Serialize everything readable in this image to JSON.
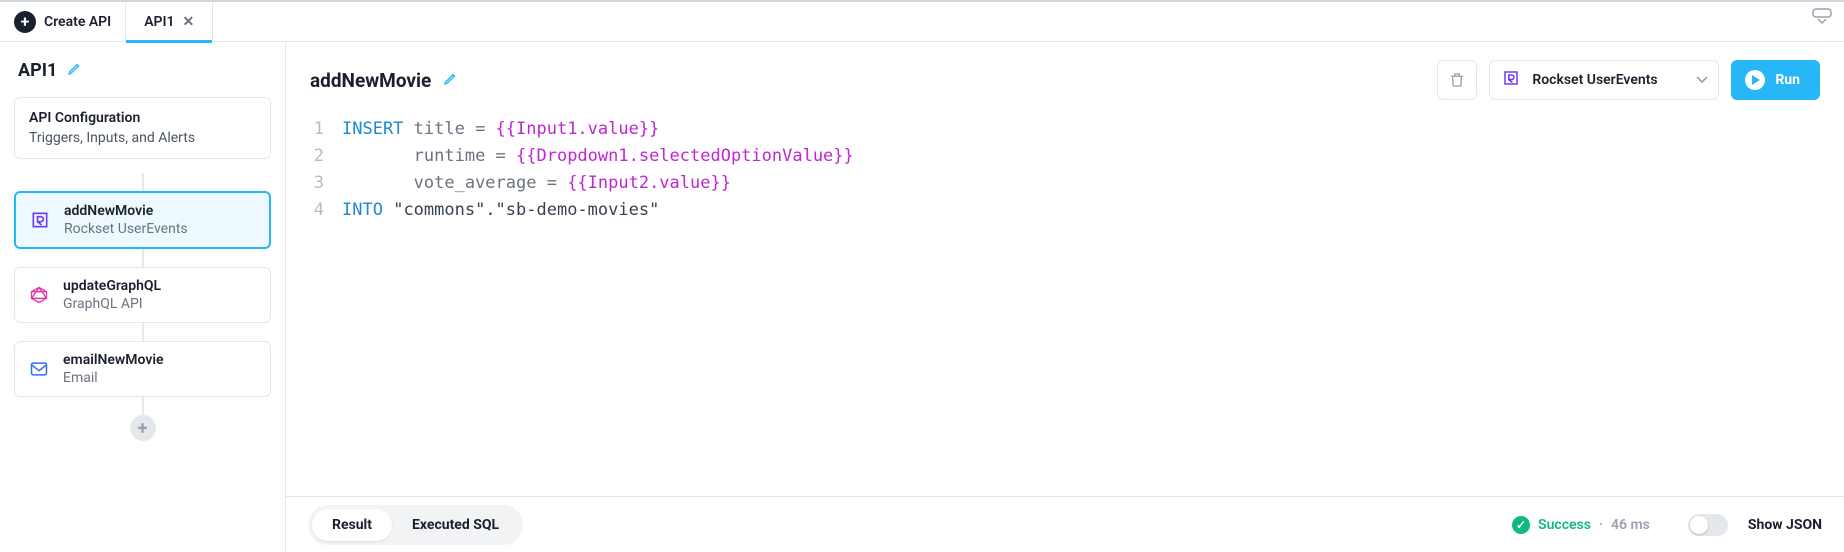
{
  "topbar": {
    "create_label": "Create API",
    "tabs": [
      {
        "label": "API1",
        "active": true
      }
    ]
  },
  "sidebar": {
    "api_name": "API1",
    "config": {
      "title": "API Configuration",
      "subtitle": "Triggers, Inputs, and Alerts"
    },
    "steps": [
      {
        "name": "addNewMovie",
        "datasource": "Rockset UserEvents",
        "icon": "rockset",
        "selected": true
      },
      {
        "name": "updateGraphQL",
        "datasource": "GraphQL API",
        "icon": "graphql",
        "selected": false
      },
      {
        "name": "emailNewMovie",
        "datasource": "Email",
        "icon": "email",
        "selected": false
      }
    ]
  },
  "main": {
    "step_title": "addNewMovie",
    "datasource_select": "Rockset UserEvents",
    "run_label": "Run",
    "code": {
      "line1": {
        "kw": "INSERT",
        "t1": " title = ",
        "tpl": "{{Input1.value}}"
      },
      "line2": {
        "pad": "       ",
        "t1": "runtime = ",
        "tpl": "{{Dropdown1.selectedOptionValue}}"
      },
      "line3": {
        "pad": "       ",
        "t1": "vote_average = ",
        "tpl": "{{Input2.value}}"
      },
      "line4": {
        "kw": "INTO",
        "t1": " ",
        "str": "\"commons\".\"sb-demo-movies\""
      }
    },
    "line_numbers": [
      "1",
      "2",
      "3",
      "4"
    ]
  },
  "bottom": {
    "tabs": {
      "result": "Result",
      "executed_sql": "Executed SQL"
    },
    "status_label": "Success",
    "status_time": "46 ms",
    "show_json": "Show JSON"
  }
}
